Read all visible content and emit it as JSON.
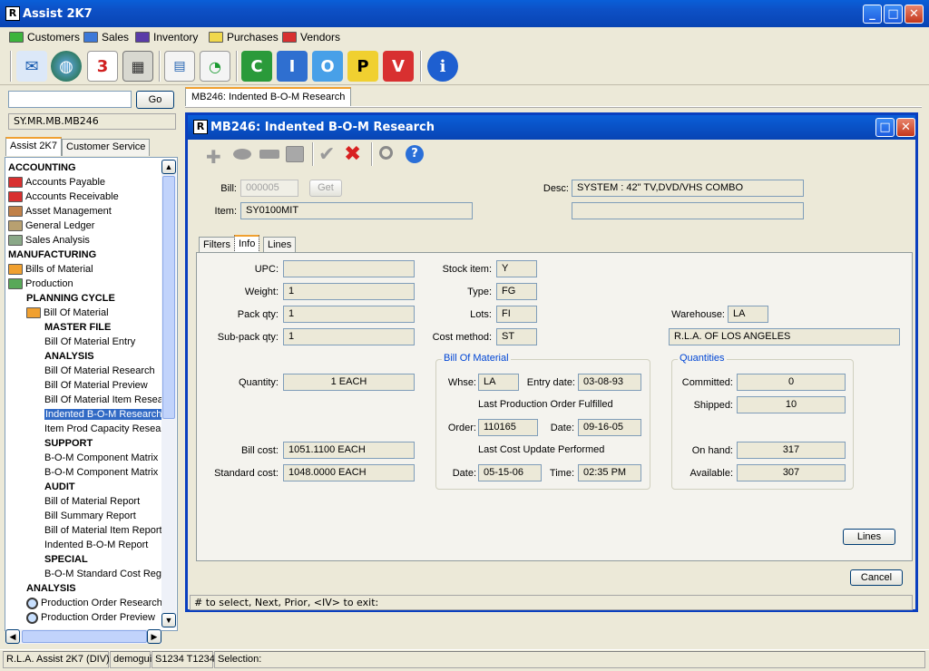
{
  "app": {
    "title": "Assist 2K7"
  },
  "menu": [
    "Customers",
    "Sales",
    "Inventory",
    "Purchases",
    "Vendors"
  ],
  "menu_colors": [
    "#3cb43c",
    "#3c78d8",
    "#5a3ca8",
    "#f0d84c",
    "#d83030"
  ],
  "toolbar": {
    "letters": [
      "C",
      "I",
      "O",
      "P",
      "V"
    ],
    "calendar_num": "3",
    "info": "i"
  },
  "left": {
    "go_label": "Go",
    "search_value": "",
    "path": "SY.MR.MB.MB246",
    "tabs": [
      "Assist 2K7",
      "Customer Service"
    ]
  },
  "tree": [
    {
      "label": "ACCOUNTING",
      "type": "h",
      "indent": 0
    },
    {
      "label": "Accounts Payable",
      "type": "folder",
      "color": "#d83030",
      "indent": 0
    },
    {
      "label": "Accounts Receivable",
      "type": "folder",
      "color": "#d83030",
      "indent": 0
    },
    {
      "label": "Asset Management",
      "type": "folder",
      "color": "#c08048",
      "indent": 0
    },
    {
      "label": "General Ledger",
      "type": "folder",
      "color": "#b8a070",
      "indent": 0
    },
    {
      "label": "Sales Analysis",
      "type": "folder",
      "color": "#8aa888",
      "indent": 0
    },
    {
      "label": "MANUFACTURING",
      "type": "h",
      "indent": 0
    },
    {
      "label": "Bills of Material",
      "type": "folder",
      "color": "#f0a030",
      "indent": 0
    },
    {
      "label": "Production",
      "type": "folder",
      "color": "#58a858",
      "indent": 0
    },
    {
      "label": "PLANNING CYCLE",
      "type": "h",
      "indent": 1
    },
    {
      "label": "Bill Of Material",
      "type": "folder",
      "color": "#f0a030",
      "indent": 1
    },
    {
      "label": "MASTER FILE",
      "type": "h",
      "indent": 2
    },
    {
      "label": "Bill Of Material Entry",
      "type": "t",
      "indent": 2
    },
    {
      "label": "ANALYSIS",
      "type": "h",
      "indent": 2
    },
    {
      "label": "Bill Of Material Research",
      "type": "t",
      "indent": 2
    },
    {
      "label": "Bill Of Material Preview",
      "type": "t",
      "indent": 2
    },
    {
      "label": "Bill Of Material Item Resear",
      "type": "t",
      "indent": 2
    },
    {
      "label": "Indented B-O-M Research",
      "type": "sel",
      "indent": 2
    },
    {
      "label": "Item Prod Capacity Resear",
      "type": "t",
      "indent": 2
    },
    {
      "label": "SUPPORT",
      "type": "h",
      "indent": 2
    },
    {
      "label": "B-O-M Component Matrix E",
      "type": "t",
      "indent": 2
    },
    {
      "label": "B-O-M Component Matrix L",
      "type": "t",
      "indent": 2
    },
    {
      "label": "AUDIT",
      "type": "h",
      "indent": 2
    },
    {
      "label": "Bill of Material Report",
      "type": "t",
      "indent": 2
    },
    {
      "label": "Bill Summary Report",
      "type": "t",
      "indent": 2
    },
    {
      "label": "Bill of Material Item Report",
      "type": "t",
      "indent": 2
    },
    {
      "label": "Indented B-O-M Report",
      "type": "t",
      "indent": 2
    },
    {
      "label": "SPECIAL",
      "type": "h",
      "indent": 2
    },
    {
      "label": "B-O-M Standard Cost Regu",
      "type": "t",
      "indent": 2
    },
    {
      "label": "ANALYSIS",
      "type": "h",
      "indent": 1
    },
    {
      "label": "Production Order Research",
      "type": "mag",
      "indent": 1
    },
    {
      "label": "Production Order Preview",
      "type": "mag",
      "indent": 1
    }
  ],
  "doc_tab": "MB246: Indented B-O-M Research",
  "window": {
    "title": "MB246: Indented B-O-M Research",
    "bill_label": "Bill:",
    "bill_value": "000005",
    "get_label": "Get",
    "item_label": "Item:",
    "item_value": "SY0100MIT",
    "desc_label": "Desc:",
    "desc_value": "SYSTEM : 42\" TV,DVD/VHS COMBO",
    "desc2_value": "",
    "tabs": [
      "Filters",
      "Info",
      "Lines"
    ],
    "upc_label": "UPC:",
    "upc_value": "",
    "weight_label": "Weight:",
    "weight_value": "1",
    "packqty_label": "Pack qty:",
    "packqty_value": "1",
    "subpack_label": "Sub-pack qty:",
    "subpack_value": "1",
    "quantity_label": "Quantity:",
    "quantity_value": "1  EACH",
    "billcost_label": "Bill cost:",
    "billcost_value": "1051.1100 EACH",
    "stdcost_label": "Standard cost:",
    "stdcost_value": "1048.0000 EACH",
    "stock_label": "Stock item:",
    "stock_value": "Y",
    "type_label": "Type:",
    "type_value": "FG",
    "lots_label": "Lots:",
    "lots_value": "FI",
    "costm_label": "Cost method:",
    "costm_value": "ST",
    "warehouse_label": "Warehouse:",
    "warehouse_value": "LA",
    "warehouse_name": "R.L.A. OF LOS ANGELES",
    "bom_group": "Bill Of Material",
    "whse_label": "Whse:",
    "whse_value": "LA",
    "entry_label": "Entry date:",
    "entry_value": "03-08-93",
    "lastprod_text": "Last Production Order Fulfilled",
    "order_label": "Order:",
    "order_value": "110165",
    "date_label": "Date:",
    "date_value": "09-16-05",
    "lastcost_text": "Last Cost Update Performed",
    "date2_label": "Date:",
    "date2_value": "05-15-06",
    "time_label": "Time:",
    "time_value": "02:35 PM",
    "qty_group": "Quantities",
    "committed_label": "Committed:",
    "committed_value": "0",
    "shipped_label": "Shipped:",
    "shipped_value": "10",
    "onhand_label": "On hand:",
    "onhand_value": "317",
    "available_label": "Available:",
    "available_value": "307",
    "lines_button": "Lines",
    "cancel_button": "Cancel",
    "hint": "# to select,  Next,  Prior,  <IV> to exit:"
  },
  "status": {
    "app": "R.L.A. Assist 2K7 (DIV)",
    "user": "demogui",
    "ports": "S1234 T1234",
    "selection": "Selection:"
  }
}
